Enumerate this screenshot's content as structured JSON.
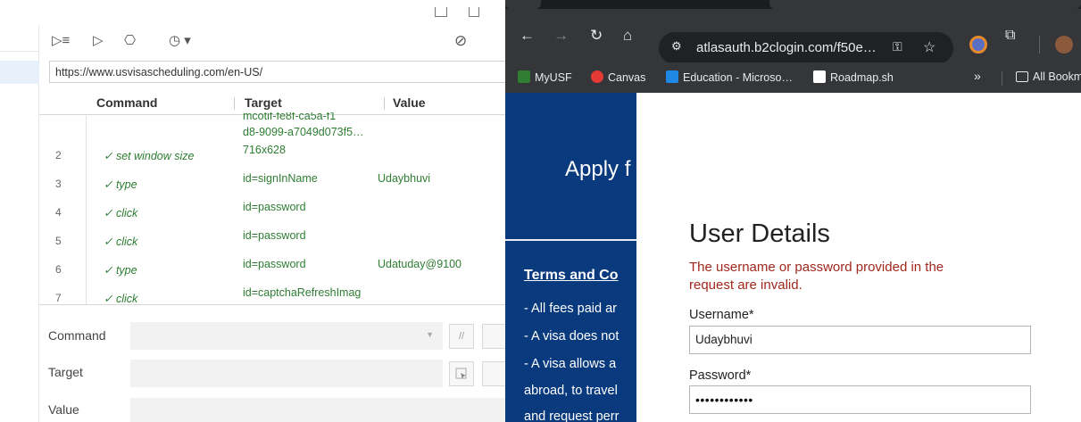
{
  "ide": {
    "url": "https://www.usvisascheduling.com/en-US/",
    "columns": {
      "command": "Command",
      "target": "Target",
      "value": "Value"
    },
    "cut_target": "d8-9099-a7049d073f5…",
    "rows": [
      {
        "num": "2",
        "command": "✓ set window size",
        "target": "716x628",
        "value": ""
      },
      {
        "num": "3",
        "command": "✓ type",
        "target": "id=signInName",
        "value": "Udaybhuvi"
      },
      {
        "num": "4",
        "command": "✓ click",
        "target": "id=password",
        "value": ""
      },
      {
        "num": "5",
        "command": "✓ click",
        "target": "id=password",
        "value": ""
      },
      {
        "num": "6",
        "command": "✓ type",
        "target": "id=password",
        "value": "Udatuday@9100"
      },
      {
        "num": "7",
        "command": "✓ click",
        "target": "id=captchaRefreshImag",
        "value": ""
      }
    ],
    "editor": {
      "command_label": "Command",
      "target_label": "Target",
      "value_label": "Value",
      "comment_btn": "//"
    },
    "icons": {
      "run_all": "▷≡",
      "run": "▷",
      "step": "⎔",
      "speed": "◷ ▾",
      "disable_breakpoints": "⊘"
    }
  },
  "chrome": {
    "address": "atlasauth.b2clogin.com/f50e…",
    "bookmarks": [
      {
        "label": "MyUSF",
        "icon": "myusf-icon",
        "color": "#2e7d32"
      },
      {
        "label": "Canvas",
        "icon": "canvas-icon",
        "color": "#e53935"
      },
      {
        "label": "Education - Microso…",
        "icon": "azure-icon",
        "color": "#1e88e5"
      },
      {
        "label": "Roadmap.sh",
        "icon": "roadmap-icon",
        "color": "#ffffff"
      }
    ],
    "bookmarks_overflow": "»",
    "all_bookmarks": "All Bookm",
    "page": {
      "apply_text": "Apply f",
      "terms_heading": "Terms and Co",
      "bullets": [
        "- All fees paid ar",
        "- A visa does not",
        "- A visa allows a",
        "abroad, to travel",
        "and request perr"
      ],
      "form_title": "User Details",
      "error": "The username or password provided in the request are invalid.",
      "username_label": "Username*",
      "username_value": "Udaybhuvi",
      "password_label": "Password*",
      "password_value": "••••••••••••"
    },
    "colors": {
      "brand_blue": "#0a3a7e",
      "error_red": "#a0281c",
      "success_green": "#2e7d32"
    }
  }
}
